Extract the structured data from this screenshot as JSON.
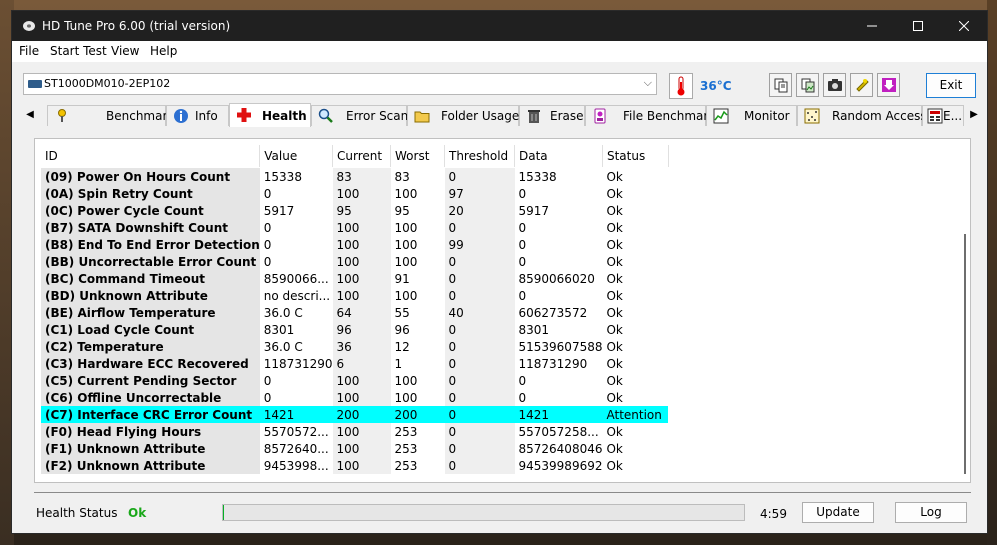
{
  "window": {
    "title": "HD Tune Pro 6.00 (trial version)"
  },
  "menu": [
    "File",
    "Start Test",
    "View",
    "Help"
  ],
  "drive": {
    "name": "ST1000DM010-2EP102"
  },
  "temperature": "36°C",
  "toolbar": {
    "exit_label": "Exit"
  },
  "tabs": [
    {
      "label": "Benchmark",
      "icon": "benchmark-icon"
    },
    {
      "label": "Info",
      "icon": "info-icon"
    },
    {
      "label": "Health",
      "icon": "health-cross-icon",
      "active": true
    },
    {
      "label": "Error Scan",
      "icon": "error-scan-icon"
    },
    {
      "label": "Folder Usage",
      "icon": "folder-icon"
    },
    {
      "label": "Erase",
      "icon": "trash-icon"
    },
    {
      "label": "File Benchmark",
      "icon": "file-benchmark-icon"
    },
    {
      "label": "Monitor",
      "icon": "monitor-icon"
    },
    {
      "label": "Random Access",
      "icon": "random-access-icon"
    },
    {
      "label": "E...",
      "icon": "extra-tests-icon"
    }
  ],
  "table": {
    "headers": [
      "ID",
      "Value",
      "Current",
      "Worst",
      "Threshold",
      "Data",
      "Status"
    ],
    "rows": [
      [
        "(09) Power On Hours Count",
        "15338",
        "83",
        "83",
        "0",
        "15338",
        "Ok"
      ],
      [
        "(0A) Spin Retry Count",
        "0",
        "100",
        "100",
        "97",
        "0",
        "Ok"
      ],
      [
        "(0C) Power Cycle Count",
        "5917",
        "95",
        "95",
        "20",
        "5917",
        "Ok"
      ],
      [
        "(B7) SATA Downshift Count",
        "0",
        "100",
        "100",
        "0",
        "0",
        "Ok"
      ],
      [
        "(B8) End To End Error Detection",
        "0",
        "100",
        "100",
        "99",
        "0",
        "Ok"
      ],
      [
        "(BB) Uncorrectable Error Count",
        "0",
        "100",
        "100",
        "0",
        "0",
        "Ok"
      ],
      [
        "(BC) Command Timeout",
        "8590066...",
        "100",
        "91",
        "0",
        "8590066020",
        "Ok"
      ],
      [
        "(BD) Unknown Attribute",
        "no descri...",
        "100",
        "100",
        "0",
        "0",
        "Ok"
      ],
      [
        "(BE) Airflow Temperature",
        "36.0 C",
        "64",
        "55",
        "40",
        "606273572",
        "Ok"
      ],
      [
        "(C1) Load Cycle Count",
        "8301",
        "96",
        "96",
        "0",
        "8301",
        "Ok"
      ],
      [
        "(C2) Temperature",
        "36.0 C",
        "36",
        "12",
        "0",
        "51539607588",
        "Ok"
      ],
      [
        "(C3) Hardware ECC Recovered",
        "118731290",
        "6",
        "1",
        "0",
        "118731290",
        "Ok"
      ],
      [
        "(C5) Current Pending Sector",
        "0",
        "100",
        "100",
        "0",
        "0",
        "Ok"
      ],
      [
        "(C6) Offline Uncorrectable",
        "0",
        "100",
        "100",
        "0",
        "0",
        "Ok"
      ],
      [
        "(C7) Interface CRC Error Count",
        "1421",
        "200",
        "200",
        "0",
        "1421",
        "Attention"
      ],
      [
        "(F0) Head Flying Hours",
        "5570572...",
        "100",
        "253",
        "0",
        "557057258...",
        "Ok"
      ],
      [
        "(F1) Unknown Attribute",
        "8572640...",
        "100",
        "253",
        "0",
        "85726408046",
        "Ok"
      ],
      [
        "(F2) Unknown Attribute",
        "9453998...",
        "100",
        "253",
        "0",
        "94539989692",
        "Ok"
      ]
    ],
    "highlight_row": 14,
    "highlight_color": "#00ffff"
  },
  "status": {
    "label": "Health Status",
    "value": "Ok",
    "value_color": "#1aa81a",
    "progress_fraction": 0.0,
    "time": "4:59",
    "update_label": "Update",
    "log_label": "Log"
  }
}
